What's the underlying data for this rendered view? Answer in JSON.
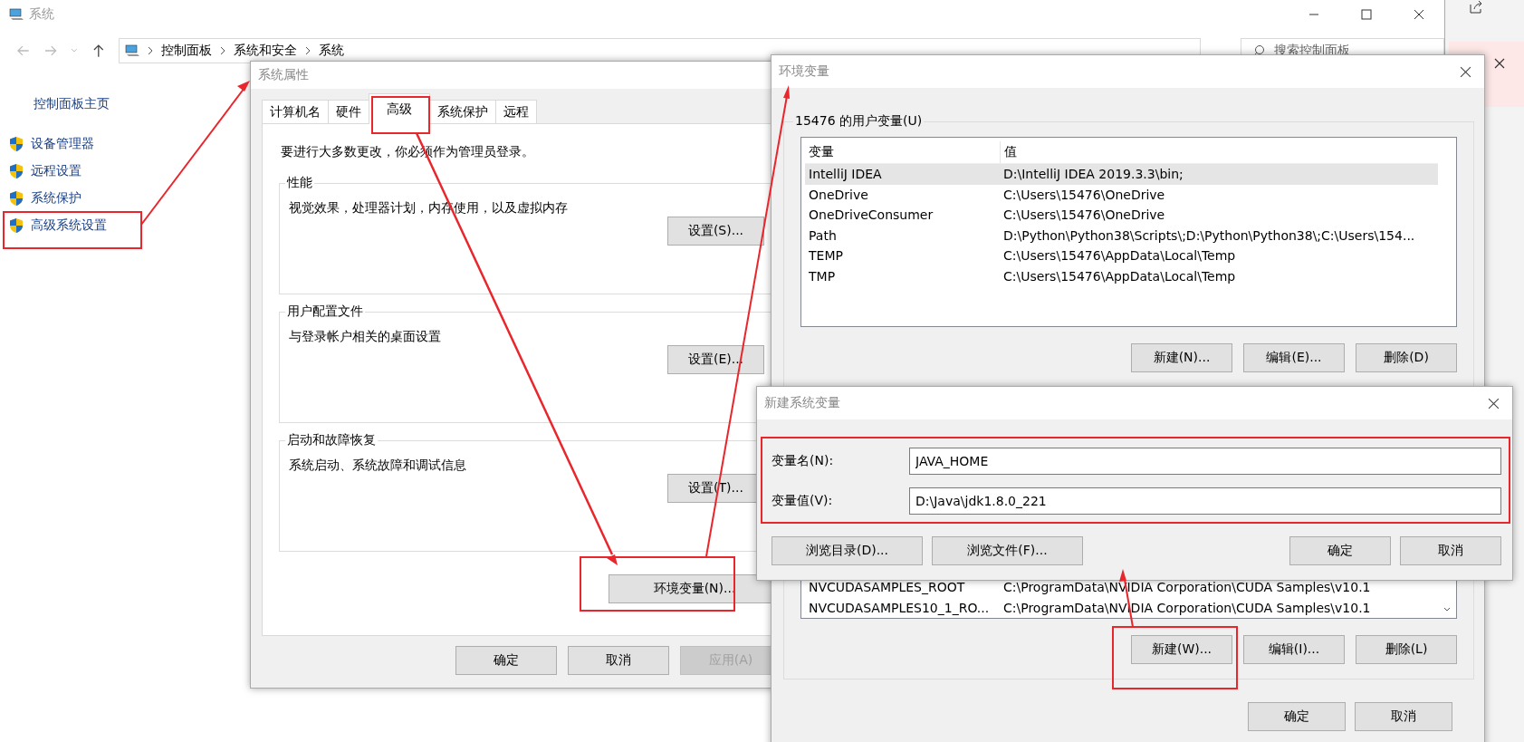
{
  "control_panel": {
    "title": "系统",
    "breadcrumb": [
      "控制面板",
      "系统和安全",
      "系统"
    ],
    "search": {
      "placeholder": "搜索控制面板"
    },
    "sidebar": {
      "home": "控制面板主页",
      "items": [
        {
          "label": "设备管理器"
        },
        {
          "label": "远程设置"
        },
        {
          "label": "系统保护"
        },
        {
          "label": "高级系统设置"
        }
      ]
    }
  },
  "system_properties": {
    "title": "系统属性",
    "tabs": [
      {
        "label": "计算机名",
        "selected": false
      },
      {
        "label": "硬件",
        "selected": false
      },
      {
        "label": "高级",
        "selected": true
      },
      {
        "label": "系统保护",
        "selected": false
      },
      {
        "label": "远程",
        "selected": false
      }
    ],
    "notice": "要进行大多数更改，你必须作为管理员登录。",
    "groups": [
      {
        "title": "性能",
        "description": "视觉效果，处理器计划，内存使用，以及虚拟内存",
        "button": "设置(S)..."
      },
      {
        "title": "用户配置文件",
        "description": "与登录帐户相关的桌面设置",
        "button": "设置(E)..."
      },
      {
        "title": "启动和故障恢复",
        "description": "系统启动、系统故障和调试信息",
        "button": "设置(T)..."
      }
    ],
    "env_button": "环境变量(N)...",
    "buttons": [
      {
        "label": "确定",
        "disabled": false
      },
      {
        "label": "取消",
        "disabled": false
      },
      {
        "label": "应用(A)",
        "disabled": true
      }
    ]
  },
  "environment_variables": {
    "title": "环境变量",
    "user_group": "15476 的用户变量(U)",
    "columns": [
      "变量",
      "值"
    ],
    "user_rows": [
      {
        "name": "IntelliJ IDEA",
        "value": "D:\\IntelliJ IDEA 2019.3.3\\bin;",
        "selected": true
      },
      {
        "name": "OneDrive",
        "value": "C:\\Users\\15476\\OneDrive",
        "selected": false
      },
      {
        "name": "OneDriveConsumer",
        "value": "C:\\Users\\15476\\OneDrive",
        "selected": false
      },
      {
        "name": "Path",
        "value": "D:\\Python\\Python38\\Scripts\\;D:\\Python\\Python38\\;C:\\Users\\154...",
        "selected": false
      },
      {
        "name": "TEMP",
        "value": "C:\\Users\\15476\\AppData\\Local\\Temp",
        "selected": false
      },
      {
        "name": "TMP",
        "value": "C:\\Users\\15476\\AppData\\Local\\Temp",
        "selected": false
      }
    ],
    "user_buttons": [
      "新建(N)...",
      "编辑(E)...",
      "删除(D)"
    ],
    "system_rows": [
      {
        "name": "NVCUDASAMPLES_ROOT",
        "value": "C:\\ProgramData\\NVIDIA Corporation\\CUDA Samples\\v10.1"
      },
      {
        "name": "NVCUDASAMPLES10_1_RO...",
        "value": "C:\\ProgramData\\NVIDIA Corporation\\CUDA Samples\\v10.1"
      }
    ],
    "system_buttons": [
      "新建(W)...",
      "编辑(I)...",
      "删除(L)"
    ],
    "buttons": [
      "确定",
      "取消"
    ]
  },
  "new_system_variable": {
    "title": "新建系统变量",
    "fields": [
      {
        "label": "变量名(N):",
        "value": "JAVA_HOME"
      },
      {
        "label": "变量值(V):",
        "value": "D:\\Java\\jdk1.8.0_221"
      }
    ],
    "browse_buttons": [
      "浏览目录(D)...",
      "浏览文件(F)..."
    ],
    "buttons": [
      "确定",
      "取消"
    ]
  }
}
